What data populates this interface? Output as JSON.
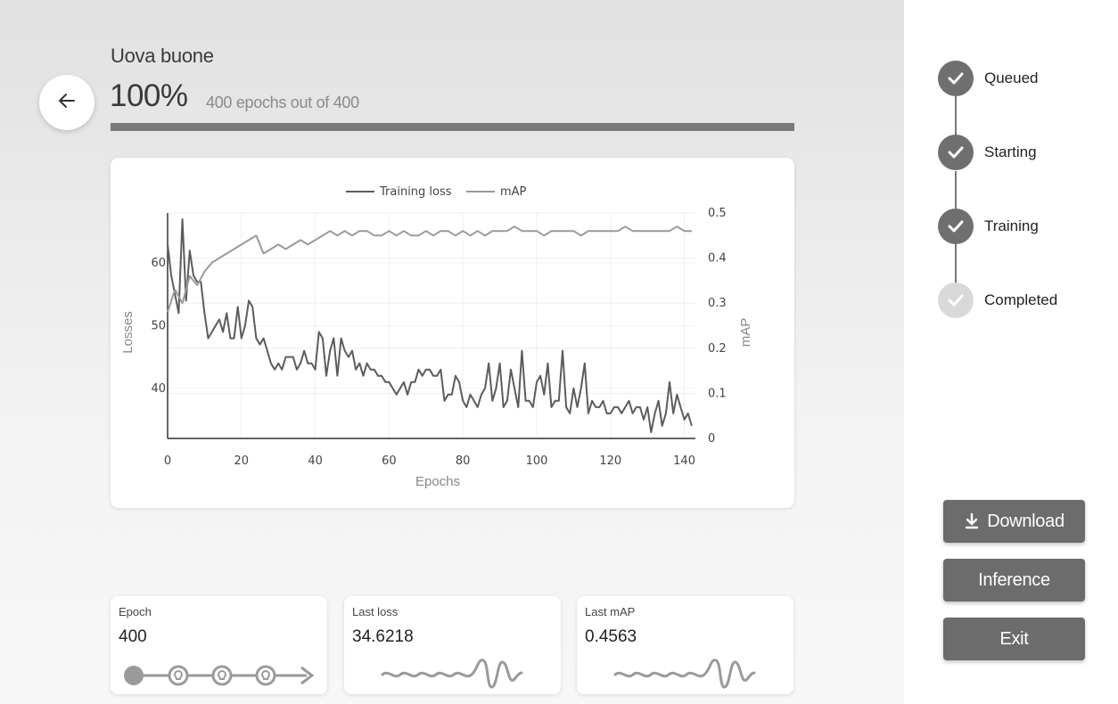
{
  "header": {
    "title": "Uova buone",
    "percent": "100%",
    "epochs_text": "400 epochs out of 400",
    "progress": 1.0
  },
  "chart_data": {
    "type": "line",
    "legend": [
      "Training loss",
      "mAP"
    ],
    "legend_position": "top-center",
    "xlabel": "Epochs",
    "ylabel": "Losses",
    "y2label": "mAP",
    "xlim": [
      0,
      143
    ],
    "ylim": [
      32,
      68
    ],
    "y2lim": [
      0,
      0.5
    ],
    "xticks": [
      "0",
      "20",
      "40",
      "60",
      "80",
      "100",
      "120",
      "140"
    ],
    "yticks": [
      "40",
      "50",
      "60"
    ],
    "y2ticks": [
      "0",
      "0.1",
      "0.2",
      "0.3",
      "0.4",
      "0.5"
    ],
    "grid": true,
    "series": [
      {
        "name": "Training loss",
        "axis": "left",
        "color": "#5c5c5c",
        "x": [
          0,
          1,
          2,
          3,
          4,
          5,
          6,
          7,
          8,
          9,
          10,
          11,
          12,
          13,
          14,
          15,
          16,
          17,
          18,
          19,
          20,
          21,
          22,
          23,
          24,
          25,
          26,
          27,
          28,
          29,
          30,
          31,
          32,
          33,
          34,
          35,
          36,
          37,
          38,
          39,
          40,
          41,
          42,
          43,
          44,
          45,
          46,
          47,
          48,
          49,
          50,
          51,
          52,
          53,
          54,
          55,
          56,
          57,
          58,
          59,
          60,
          61,
          62,
          63,
          64,
          65,
          66,
          67,
          68,
          69,
          70,
          71,
          72,
          73,
          74,
          75,
          76,
          77,
          78,
          79,
          80,
          81,
          82,
          83,
          84,
          85,
          86,
          87,
          88,
          89,
          90,
          91,
          92,
          93,
          94,
          95,
          96,
          97,
          98,
          99,
          100,
          101,
          102,
          103,
          104,
          105,
          106,
          107,
          108,
          109,
          110,
          111,
          112,
          113,
          114,
          115,
          116,
          117,
          118,
          119,
          120,
          121,
          122,
          123,
          124,
          125,
          126,
          127,
          128,
          129,
          130,
          131,
          132,
          133,
          134,
          135,
          136,
          137,
          138,
          139,
          140,
          141,
          142
        ],
        "values": [
          63,
          58,
          55,
          52,
          67,
          54,
          62,
          58,
          57,
          57,
          52,
          48,
          49,
          50,
          51,
          49,
          52,
          48,
          48,
          53,
          48,
          50,
          54,
          53,
          48,
          47,
          48,
          46,
          44,
          43,
          44,
          43,
          45,
          45,
          45,
          43,
          44,
          46,
          44,
          44,
          43,
          49,
          48,
          42,
          46,
          48,
          42,
          48,
          46,
          45,
          46,
          43,
          44,
          42,
          44,
          43,
          43,
          42,
          42,
          41,
          41,
          40,
          39,
          40,
          41,
          39,
          41,
          41,
          43,
          42,
          43,
          43,
          42,
          42,
          43,
          38,
          39,
          39,
          42,
          41,
          38,
          37,
          39,
          38,
          37,
          39,
          40,
          44,
          38,
          40,
          44,
          37,
          38,
          43,
          40,
          37,
          46,
          38,
          38,
          37,
          41,
          42,
          39,
          44,
          37,
          38,
          38,
          46,
          37,
          36,
          40,
          37,
          40,
          44,
          36,
          38,
          37,
          37,
          38,
          36,
          36,
          37,
          37,
          36,
          37,
          38,
          36,
          37,
          37,
          35,
          37,
          33,
          36,
          38,
          34,
          36,
          41,
          36,
          39,
          37,
          35,
          36,
          34
        ]
      },
      {
        "name": "mAP",
        "axis": "right",
        "color": "#9a9a9a",
        "x": [
          0,
          2,
          4,
          6,
          8,
          10,
          12,
          14,
          16,
          18,
          20,
          22,
          24,
          26,
          28,
          30,
          32,
          34,
          36,
          38,
          40,
          42,
          44,
          46,
          48,
          50,
          52,
          54,
          56,
          58,
          60,
          62,
          64,
          66,
          68,
          70,
          72,
          74,
          76,
          78,
          80,
          82,
          84,
          86,
          88,
          90,
          92,
          94,
          96,
          98,
          100,
          102,
          104,
          106,
          108,
          110,
          112,
          114,
          116,
          118,
          120,
          122,
          124,
          126,
          128,
          130,
          132,
          134,
          136,
          138,
          140,
          142
        ],
        "values": [
          0.28,
          0.33,
          0.3,
          0.36,
          0.34,
          0.37,
          0.39,
          0.4,
          0.41,
          0.42,
          0.43,
          0.44,
          0.45,
          0.41,
          0.42,
          0.43,
          0.42,
          0.43,
          0.44,
          0.43,
          0.44,
          0.45,
          0.46,
          0.45,
          0.46,
          0.45,
          0.46,
          0.46,
          0.45,
          0.45,
          0.46,
          0.45,
          0.46,
          0.45,
          0.45,
          0.46,
          0.45,
          0.46,
          0.46,
          0.45,
          0.46,
          0.45,
          0.46,
          0.45,
          0.46,
          0.46,
          0.46,
          0.47,
          0.46,
          0.46,
          0.46,
          0.45,
          0.46,
          0.46,
          0.46,
          0.46,
          0.45,
          0.46,
          0.46,
          0.46,
          0.46,
          0.46,
          0.47,
          0.46,
          0.46,
          0.46,
          0.46,
          0.46,
          0.46,
          0.47,
          0.46,
          0.46
        ]
      }
    ]
  },
  "stats": [
    {
      "label": "Epoch",
      "value": "400"
    },
    {
      "label": "Last loss",
      "value": "34.6218"
    },
    {
      "label": "Last mAP",
      "value": "0.4563"
    }
  ],
  "steps": [
    {
      "label": "Queued",
      "done": true
    },
    {
      "label": "Starting",
      "done": true
    },
    {
      "label": "Training",
      "done": true
    },
    {
      "label": "Completed",
      "done": false
    }
  ],
  "buttons": {
    "download": "Download",
    "inference": "Inference",
    "exit": "Exit"
  },
  "icons": {
    "back": "arrow-left-icon",
    "download": "download-icon",
    "check": "check-icon"
  },
  "colors": {
    "accent": "#6c6c6c",
    "loss": "#5c5c5c",
    "map": "#9a9a9a"
  }
}
